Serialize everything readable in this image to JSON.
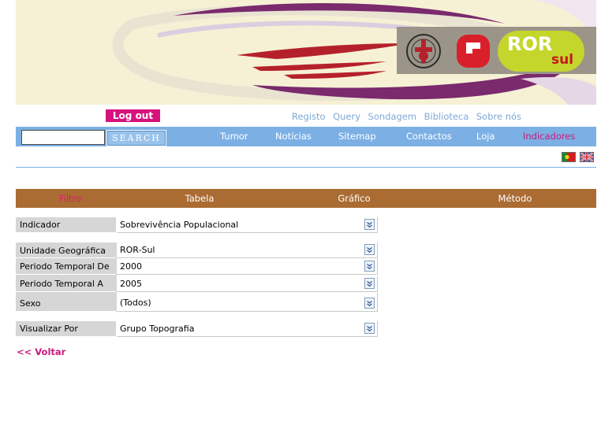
{
  "banner": {
    "ror_text": "ROR",
    "sul_text": "sul"
  },
  "auth": {
    "logout_label": "Log out"
  },
  "top_links": [
    "Registo",
    "Query",
    "Sondagem",
    "Biblioteca",
    "Sobre nós"
  ],
  "search": {
    "value": "",
    "button_label": "SEARCH"
  },
  "nav": {
    "items": [
      "Tumor",
      "Notícias",
      "Sitemap",
      "Contactos",
      "Loja",
      "Indicadores"
    ],
    "active": "Indicadores"
  },
  "languages": [
    "pt-flag-icon",
    "uk-flag-icon"
  ],
  "tabs": {
    "items": [
      "Filtro",
      "Tabela",
      "Gráfico",
      "Método"
    ],
    "active": "Filtro"
  },
  "form": {
    "indicador": {
      "label": "Indicador",
      "value": "Sobrevivência Populacional"
    },
    "unidade": {
      "label": "Unidade Geográfica",
      "value": "ROR-Sul"
    },
    "periodo_de": {
      "label": "Periodo Temporal De",
      "value": "2000"
    },
    "periodo_a": {
      "label": "Periodo Temporal A",
      "value": "2005"
    },
    "sexo": {
      "label": "Sexo",
      "value": "(Todos)"
    },
    "visualizar": {
      "label": "Visualizar Por",
      "value": "Grupo Topografia"
    }
  },
  "back_link": "<< Voltar",
  "colors": {
    "nav_bar": "#7cb0e4",
    "tab_bar": "#aa6c33",
    "accent_pink": "#c71a7c",
    "logout_bg": "#d6127d",
    "label_bg": "#d6d6d6"
  }
}
